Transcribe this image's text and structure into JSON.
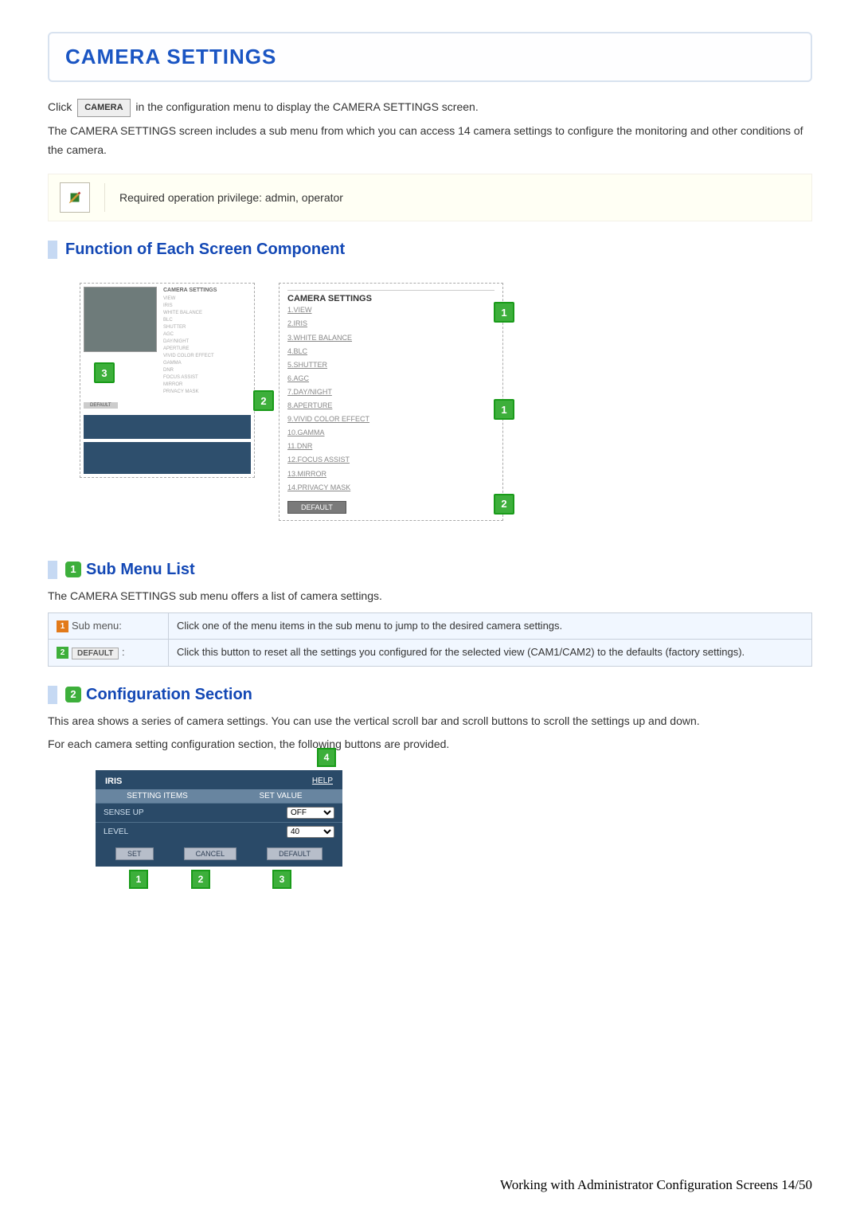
{
  "title": "CAMERA SETTINGS",
  "intro": {
    "click_prefix": "Click",
    "camera_btn": "CAMERA",
    "click_suffix": "in the configuration menu to display the CAMERA SETTINGS screen.",
    "line2": "The CAMERA SETTINGS screen includes a sub menu from which you can access 14 camera settings to configure the monitoring and other conditions of the camera."
  },
  "note": "Required operation privilege: admin, operator",
  "section1": {
    "heading": "Function of Each Screen Component",
    "mock_left_title": "CAMERA SETTINGS",
    "mock_left_items": [
      "VIEW",
      "IRIS",
      "WHITE BALANCE",
      "BLC",
      "SHUTTER",
      "AGC",
      "DAY/NIGHT",
      "APERTURE",
      "VIVID COLOR EFFECT",
      "GAMMA",
      "DNR",
      "FOCUS ASSIST",
      "MIRROR",
      "PRIVACY MASK"
    ],
    "mock_left_default": "DEFAULT",
    "mock_right_title": "CAMERA SETTINGS",
    "mock_right_items": [
      "1.VIEW",
      "2.IRIS",
      "3.WHITE BALANCE",
      "4.BLC",
      "5.SHUTTER",
      "6.AGC",
      "7.DAY/NIGHT",
      "8.APERTURE",
      "9.VIVID COLOR EFFECT",
      "10.GAMMA",
      "11.DNR",
      "12.FOCUS ASSIST",
      "13.MIRROR",
      "14.PRIVACY MASK"
    ],
    "mock_right_default": "DEFAULT"
  },
  "submenu": {
    "badge": "1",
    "heading": "Sub Menu List",
    "desc": "The CAMERA SETTINGS sub menu offers a list of camera settings.",
    "row1_num": "1",
    "row1_label": "Sub menu:",
    "row1_text": "Click one of the menu items in the sub menu to jump to the desired camera settings.",
    "row2_num": "2",
    "row2_btn": "DEFAULT",
    "row2_colon": ":",
    "row2_text": "Click this button to reset all the settings you configured for the selected view (CAM1/CAM2) to the defaults (factory settings)."
  },
  "config": {
    "badge": "2",
    "heading": "Configuration Section",
    "desc1": "This area shows a series of camera settings. You can use the vertical scroll bar and scroll buttons to scroll the settings up and down.",
    "desc2": "For each camera setting configuration section, the following buttons are provided.",
    "iris_title": "IRIS",
    "iris_help": "HELP",
    "iris_col1": "SETTING ITEMS",
    "iris_col2": "SET VALUE",
    "iris_r1_label": "SENSE UP",
    "iris_r1_value": "OFF",
    "iris_r2_label": "LEVEL",
    "iris_r2_value": "40",
    "iris_btn_set": "SET",
    "iris_btn_cancel": "CANCEL",
    "iris_btn_default": "DEFAULT",
    "call1": "1",
    "call2": "2",
    "call3": "3",
    "call4": "4"
  },
  "footer": "Working with Administrator Configuration Screens 14/50"
}
